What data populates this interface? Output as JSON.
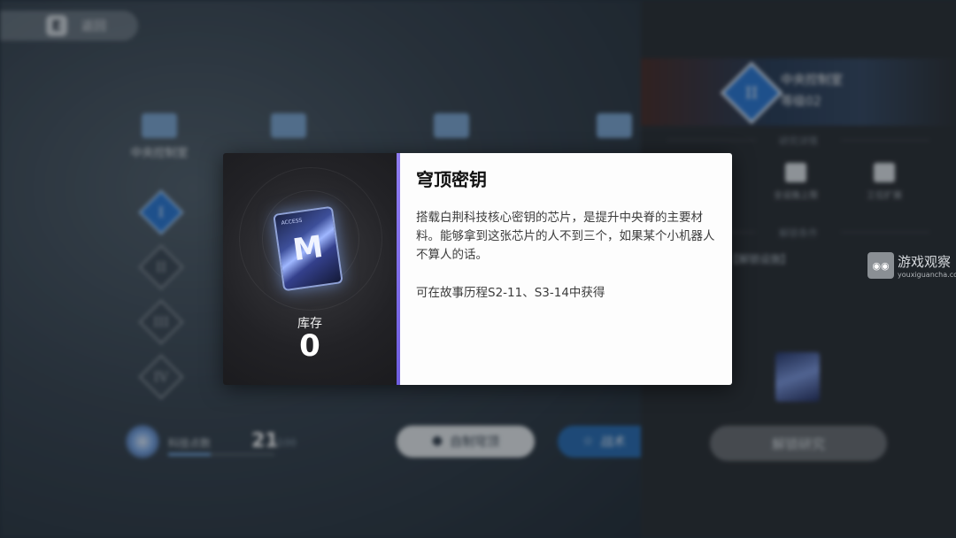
{
  "header": {
    "back_label": "返回"
  },
  "tabs": [
    {
      "label": "中央控制室"
    },
    {
      "label": ""
    },
    {
      "label": ""
    },
    {
      "label": ""
    }
  ],
  "tiers": [
    "I",
    "II",
    "III",
    "IV"
  ],
  "research_points": {
    "label": "科技点数",
    "value": "21",
    "max": "/100",
    "progress": 0.4
  },
  "buttons": {
    "auto_assign": "自制穹顶",
    "battle": "战术"
  },
  "right_panel": {
    "room_title": "中央控制室",
    "level": "等级02",
    "tier": "II",
    "section_detail": "研究详情",
    "icons": [
      {
        "label": ""
      },
      {
        "label": "全设施上限"
      },
      {
        "label": "工位扩展"
      }
    ],
    "section_conditions": "解锁条件",
    "condition_text": "【解锁设施】",
    "unlock_button": "解锁研究"
  },
  "popup": {
    "item_name": "穹顶密钥",
    "description": "搭载白荆科技核心密钥的芯片，是提升中央脊的主要材料。能够拿到这张芯片的人不到三个，如果某个小机器人不算人的话。",
    "source": "可在故事历程S2-11、S3-14中获得",
    "stock_label": "库存",
    "stock_value": "0",
    "chip_letter": "M",
    "chip_tag": "ACCESS"
  },
  "watermark": {
    "cn": "游戏观察",
    "en": "youxiguancha.com"
  },
  "colors": {
    "accent": "#8f7cf0",
    "tier_active": "#2d7ad6"
  }
}
